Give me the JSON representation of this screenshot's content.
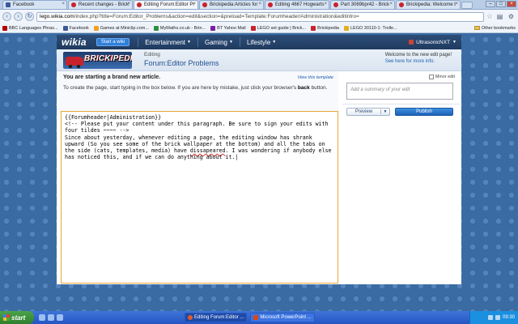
{
  "browser": {
    "tabs": [
      {
        "label": "Facebook",
        "icon": "facebook-icon",
        "active": false
      },
      {
        "label": "Recent changes - Brick",
        "icon": "brickipedia-icon",
        "active": false
      },
      {
        "label": "Editing Forum:Editor Pr",
        "icon": "brickipedia-icon",
        "active": true
      },
      {
        "label": "Brickipedia:Articles for",
        "icon": "brickipedia-icon",
        "active": false
      },
      {
        "label": "Editing 4667 Hogwarts",
        "icon": "brickipedia-icon",
        "active": false
      },
      {
        "label": "Part 3069bpr42 - Brick",
        "icon": "brickipedia-icon",
        "active": false
      },
      {
        "label": "Brickipedia: Welcome t",
        "icon": "brickipedia-icon",
        "active": false
      }
    ],
    "url_domain": "lego.wikia.com",
    "url_path": "/index.php?title=Forum:Editor_Problems&action=edit&section=&preload=Template:Forumheader/Administration&editintro=",
    "bookmarks": [
      {
        "label": "BBC Languages Phras...",
        "color": "#b40000"
      },
      {
        "label": "Facebook",
        "color": "#3b5998"
      },
      {
        "label": "Games at Miniclip.com...",
        "color": "#f0a020"
      },
      {
        "label": "MyMaths.co.uk - Brin...",
        "color": "#2f8f3f"
      },
      {
        "label": "BT Yahoo Mail",
        "color": "#7b1fa2"
      },
      {
        "label": "LEGO set guide | Brick...",
        "color": "#c8232c"
      },
      {
        "label": "Brickipedia",
        "color": "#c8232c"
      },
      {
        "label": "LEGO 30110-1: Trolle...",
        "color": "#e0b020"
      }
    ],
    "other_bookmarks": "Other bookmarks"
  },
  "wikia": {
    "logo": "wikia",
    "start_wiki": "Start a wiki",
    "nav": [
      "Entertainment",
      "Gaming",
      "Lifestyle"
    ],
    "username": "UltrasonicNXT"
  },
  "page": {
    "logo_text": "BRICKIPEDIA",
    "editing_label": "Editing",
    "title": "Forum:Editor Problems",
    "welcome_text": "Welcome to the new edit page!",
    "welcome_link": "See here for more info.",
    "notice_title": "You are starting a brand new article.",
    "notice_link": "View this template",
    "notice_body_1": "To create the page, start typing in the box below. If you are here by mistake, just click your browser's",
    "notice_body_bold": "back",
    "notice_body_2": "button."
  },
  "editor": {
    "line1": "{{Forumheader|Administration}}",
    "line2": "<!-- Please put your content under this paragraph. Be sure to sign your edits with four tildes ~~~~ -->",
    "text_before_err": "Since about yesterday, whenever editing a page, the editing window has shrank upward (So you see some of the brick wallpaper at the bottom) and all the tabs on the side (cats, templates, media) have ",
    "misspelled": "dissapeared",
    "text_after_err": ". I was wondering if anybody else has noticed this, and if we can do anything about it."
  },
  "rail": {
    "minor_edit": "Minor edit",
    "summary_placeholder": "Add a summary of your edit",
    "preview": "Preview",
    "publish": "Publish"
  },
  "taskbar": {
    "start": "start",
    "tasks": [
      {
        "label": "Editing Forum:Editor ...",
        "icon": "chrome-icon",
        "active": true
      },
      {
        "label": "Microsoft PowerPoint ...",
        "icon": "powerpoint-icon",
        "active": false
      }
    ],
    "clock": "09:30"
  }
}
